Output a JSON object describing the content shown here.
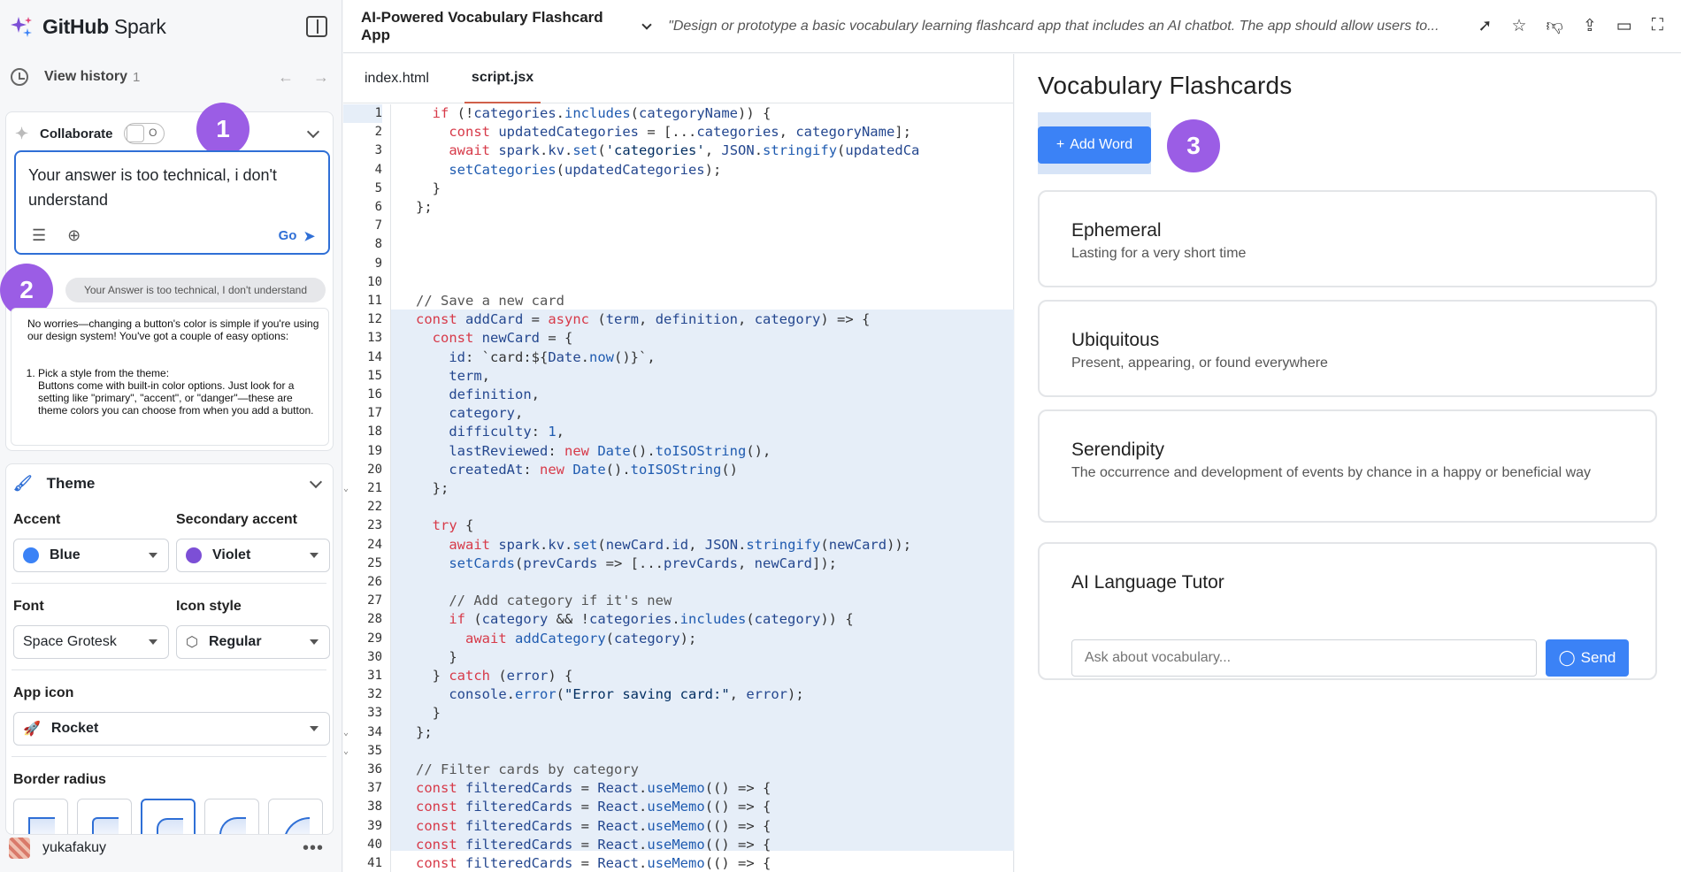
{
  "brand": {
    "name_bold": "GitHub",
    "name_regular": " Spark"
  },
  "history": {
    "label": "View history",
    "count": "1"
  },
  "collaborate": {
    "label": "Collaborate",
    "toggle_text": "O",
    "prompt_text": "Your answer is too technical, i don't understand",
    "go_label": "Go"
  },
  "annotations": {
    "one": "1",
    "two": "2",
    "three": "3"
  },
  "chat": {
    "user_message": "Your Answer is too technical, I don't understand",
    "answer_intro": "No worries—changing a button's color is simple if you're using our design system! You've got a couple of easy options:",
    "answer_item_title": "Pick a style from the theme:",
    "answer_item_body": "Buttons come with built-in color options. Just look for a setting like \"primary\", \"accent\", or \"danger\"—these are theme colors you can choose from when you add a button."
  },
  "theme": {
    "title": "Theme",
    "accent_label": "Accent",
    "accent_value": "Blue",
    "accent_color": "#3b82f6",
    "secondary_label": "Secondary accent",
    "secondary_value": "Violet",
    "secondary_color": "#7c4fd6",
    "font_label": "Font",
    "font_value": "Space Grotesk",
    "icon_style_label": "Icon style",
    "icon_style_value": "Regular",
    "app_icon_label": "App icon",
    "app_icon_value": "Rocket",
    "border_radius_label": "Border radius"
  },
  "user": {
    "name": "yukafakuy"
  },
  "topbar": {
    "app_title": "AI-Powered Vocabulary Flashcard App",
    "description": "\"Design or prototype a basic vocabulary learning flashcard app that includes an AI chatbot. The app should allow users to..."
  },
  "editor": {
    "tabs": [
      "index.html",
      "script.jsx"
    ],
    "active_tab": "script.jsx",
    "line_numbers": [
      "1",
      "2",
      "3",
      "4",
      "5",
      "6",
      "7",
      "8",
      "9",
      "10",
      "11",
      "12",
      "13",
      "14",
      "15",
      "16",
      "17",
      "18",
      "19",
      "20",
      "21",
      "22",
      "23",
      "24",
      "25",
      "26",
      "27",
      "28",
      "29",
      "30",
      "31",
      "32",
      "33",
      "34",
      "35",
      "36",
      "37",
      "38",
      "39",
      "40",
      "41"
    ]
  },
  "preview": {
    "title": "Vocabulary Flashcards",
    "add_button": "Add Word",
    "cards": [
      {
        "term": "Ephemeral",
        "definition": "Lasting for a very short time"
      },
      {
        "term": "Ubiquitous",
        "definition": "Present, appearing, or found everywhere"
      },
      {
        "term": "Serendipity",
        "definition": "The occurrence and development of events by chance in a happy or beneficial way"
      }
    ],
    "tutor": {
      "title": "AI Language Tutor",
      "placeholder": "Ask about vocabulary...",
      "send_label": "Send"
    }
  }
}
